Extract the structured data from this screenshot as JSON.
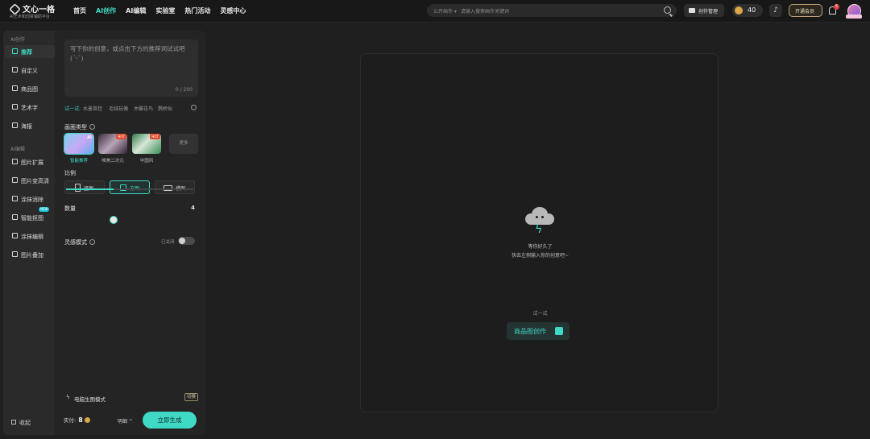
{
  "header": {
    "logo_title": "文心一格",
    "logo_subtitle": "AI艺术和创意辅助平台",
    "nav": [
      {
        "label": "首页",
        "active": false
      },
      {
        "label": "AI创作",
        "active": true
      },
      {
        "label": "AI编辑",
        "active": false
      },
      {
        "label": "实验室",
        "active": false
      },
      {
        "label": "热门活动",
        "active": false
      },
      {
        "label": "灵感中心",
        "active": false
      }
    ],
    "search": {
      "scope": "公开画作 ▾",
      "placeholder": "请输入搜索画作关键词"
    },
    "manage_label": "创作管理",
    "points": "40",
    "vip_label": "开通会员",
    "notify_count": "5"
  },
  "sidebar": {
    "section_create": "AI创作",
    "create_items": [
      {
        "label": "推荐",
        "active": true
      },
      {
        "label": "自定义",
        "active": false
      },
      {
        "label": "商品图",
        "active": false
      },
      {
        "label": "艺术字",
        "active": false
      },
      {
        "label": "海报",
        "active": false
      }
    ],
    "section_edit": "AI编辑",
    "edit_items": [
      {
        "label": "图片扩展"
      },
      {
        "label": "图片变高清"
      },
      {
        "label": "涂抹消除"
      },
      {
        "label": "智能抠图",
        "badge": "NEW"
      },
      {
        "label": "涂抹编辑"
      },
      {
        "label": "图片叠加"
      }
    ],
    "collapse_label": "收起"
  },
  "prompt": {
    "placeholder": "写下你的创意，或点击下方的推荐词试试吧(ˊᵕˋ)",
    "count": "0 / 200"
  },
  "try": {
    "label": "试一试:",
    "chips": [
      "水墨苗栓",
      "毛绒玩偶",
      "木雕花鸟",
      "鹊桥仙"
    ]
  },
  "style": {
    "label": "画面类型",
    "options": [
      {
        "name": "智能推荐",
        "selected": true
      },
      {
        "name": "唯美二次元",
        "selected": false,
        "badge": "HOT"
      },
      {
        "name": "中国风",
        "selected": false,
        "badge": "HOT"
      }
    ],
    "more_label": "更多"
  },
  "ratio": {
    "label": "比例",
    "options": [
      {
        "label": "竖图",
        "selected": false
      },
      {
        "label": "方图",
        "selected": true
      },
      {
        "label": "横图",
        "selected": false
      }
    ]
  },
  "quantity": {
    "label": "数量",
    "value": "4",
    "min": 1,
    "max": 9,
    "level": 4
  },
  "inspiration": {
    "label": "灵感模式",
    "state_label": "已关闭",
    "on": false
  },
  "mode": {
    "label": "电脑生图模式",
    "switch_label": "切换"
  },
  "footer": {
    "cost_label": "实付:",
    "cost_value": "8",
    "detail_label": "明细 ^",
    "generate_label": "立即生成"
  },
  "canvas": {
    "empty_line1": "等你好久了",
    "empty_line2": "快去左侧输入你的创意吧~",
    "try_hint": "试一试",
    "cta_label": "商品图创作"
  },
  "colors": {
    "accent": "#3fd9c5",
    "background": "#1f1f1f",
    "panel": "#242424"
  }
}
